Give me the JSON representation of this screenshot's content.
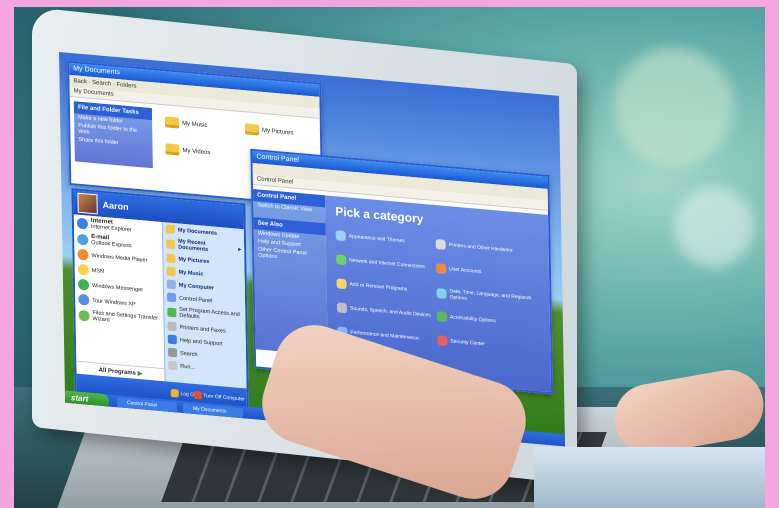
{
  "explorer": {
    "title": "My Documents",
    "toolbar": "Back · Search · Folders",
    "address": "My Documents",
    "task_header": "File and Folder Tasks",
    "tasks": [
      "Make a new folder",
      "Publish this folder to the Web",
      "Share this folder"
    ],
    "folders": [
      "My Music",
      "My Pictures",
      "My Videos"
    ]
  },
  "control_panel": {
    "title": "Control Panel",
    "address": "Control Panel",
    "side_header": "Control Panel",
    "switch_view": "Switch to Classic View",
    "see_also": "See Also",
    "see_also_items": [
      "Windows Update",
      "Help and Support",
      "Other Control Panel Options"
    ],
    "heading": "Pick a category",
    "categories": [
      "Appearance and Themes",
      "Network and Internet Connections",
      "Add or Remove Programs",
      "Sounds, Speech, and Audio Devices",
      "Performance and Maintenance",
      "Printers and Other Hardware",
      "User Accounts",
      "Date, Time, Language, and Regional Options",
      "Accessibility Options",
      "Security Center"
    ]
  },
  "start_menu": {
    "user": "Aaron",
    "pinned": [
      {
        "title": "Internet",
        "sub": "Internet Explorer"
      },
      {
        "title": "E-mail",
        "sub": "Outlook Express"
      }
    ],
    "recent": [
      "Windows Media Player",
      "MSN",
      "Windows Messenger",
      "Tour Windows XP",
      "Files and Settings Transfer Wizard"
    ],
    "all_programs": "All Programs",
    "right": [
      "My Documents",
      "My Recent Documents",
      "My Pictures",
      "My Music",
      "My Computer"
    ],
    "right_system": [
      "Control Panel",
      "Set Program Access and Defaults",
      "Printers and Faxes",
      "Help and Support",
      "Search",
      "Run..."
    ],
    "log_off": "Log Off",
    "turn_off": "Turn Off Computer"
  },
  "taskbar": {
    "start": "start",
    "buttons": [
      "Control Panel",
      "My Documents"
    ]
  },
  "colors": {
    "xp_blue": "#1e55c9",
    "start_green": "#3a9f36",
    "frame_pink": "#f4a6de"
  }
}
